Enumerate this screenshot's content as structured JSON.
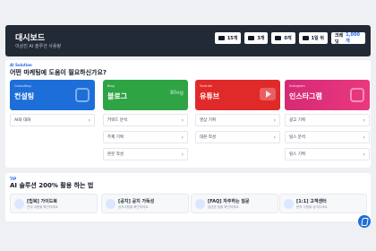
{
  "header": {
    "title": "대시보드",
    "subtitle": "이상진 AI 솔루션 사용량",
    "stats": [
      {
        "icon": "document-icon",
        "value": "15개"
      },
      {
        "icon": "chart-icon",
        "value": "3개"
      },
      {
        "icon": "video-icon",
        "value": "0개"
      },
      {
        "icon": "image-icon",
        "value": "1일 뒤"
      },
      {
        "icon": "coin-icon",
        "label": "크레딧",
        "value": "1,000개"
      }
    ]
  },
  "solution": {
    "eyebrow": "AI Solution",
    "heading": "어떤 마케팅에 도움이 필요하신가요?",
    "tiles": [
      {
        "en": "Consulting",
        "kr": "컨설팅",
        "color": "#1d6ed8",
        "rows": [
          "AI와 대화"
        ]
      },
      {
        "en": "Blog",
        "kr": "블로그",
        "deco": "Blog",
        "color": "#2ea444",
        "rows": [
          "키워드 분석",
          "주제 기획",
          "본문 작성"
        ]
      },
      {
        "en": "Youtube",
        "kr": "유튜브",
        "color": "#e02a2a",
        "rows": [
          "영상 기획",
          "대본 작성"
        ]
      },
      {
        "en": "Instagram",
        "kr": "인스타그램",
        "color": "#e0306f",
        "rows": [
          "광고 기획",
          "릴스 분석",
          "릴스 기획"
        ]
      }
    ]
  },
  "tips": {
    "eyebrow": "TIP",
    "heading": "AI 솔루션 200% 활용 하는 법",
    "items": [
      {
        "title": "[팁북] 가이드북",
        "sub": "안내 내용을 확인하세요."
      },
      {
        "title": "[공지] 공지 가독성",
        "sub": "공지사항을 확인하세요."
      },
      {
        "title": "[FAQ] 자주하는 질문",
        "sub": "궁금한 점을 확인하세요."
      },
      {
        "title": "[1:1] 고객센터",
        "sub": "문의 사항을 남겨주세요."
      }
    ]
  }
}
